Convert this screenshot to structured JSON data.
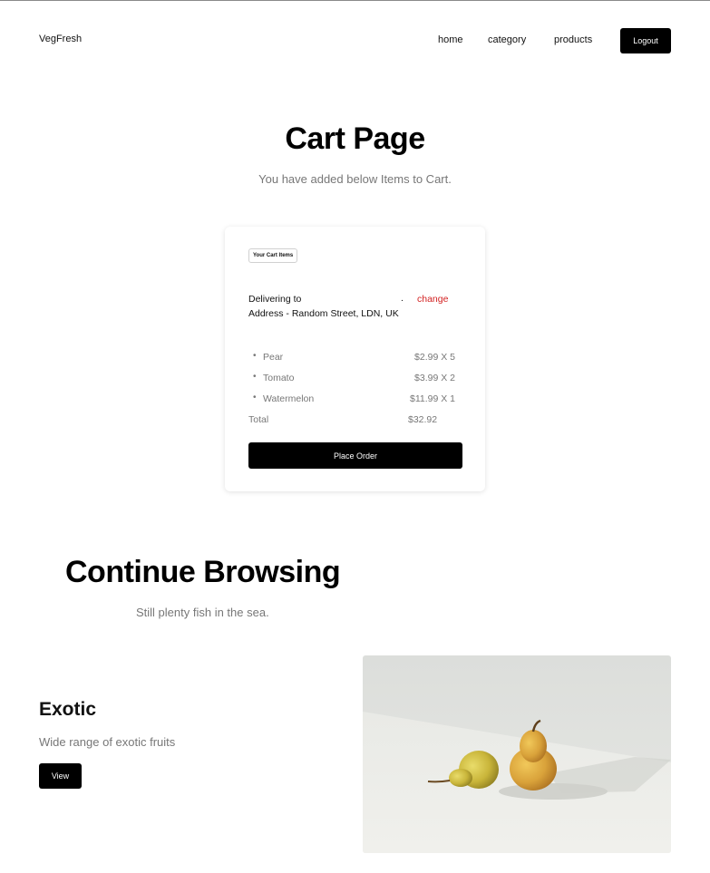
{
  "nav": {
    "brand": "VegFresh",
    "links": [
      "home",
      "category",
      "products"
    ],
    "logout_label": "Logout"
  },
  "hero": {
    "title": "Cart Page",
    "subtitle": "You have added below Items to Cart."
  },
  "cart": {
    "tag": "Your Cart Items",
    "delivering_label": "Delivering to",
    "delivering_value": ".",
    "change_label": "change",
    "address": "Address - Random Street, LDN, UK",
    "items": [
      {
        "name": "Pear",
        "price": "$2.99 X 5"
      },
      {
        "name": "Tomato",
        "price": "$3.99 X 2"
      },
      {
        "name": "Watermelon",
        "price": "$11.99 X 1"
      }
    ],
    "total_label": "Total",
    "total_value": "$32.92",
    "place_order_label": "Place Order",
    "accent_color": "#d32222"
  },
  "browse": {
    "title": "Continue Browsing",
    "subtitle": "Still plenty fish in the sea.",
    "category": {
      "title": "Exotic",
      "description": "Wide range of exotic fruits",
      "button_label": "View",
      "image_subject": "two-pears-photo"
    }
  }
}
